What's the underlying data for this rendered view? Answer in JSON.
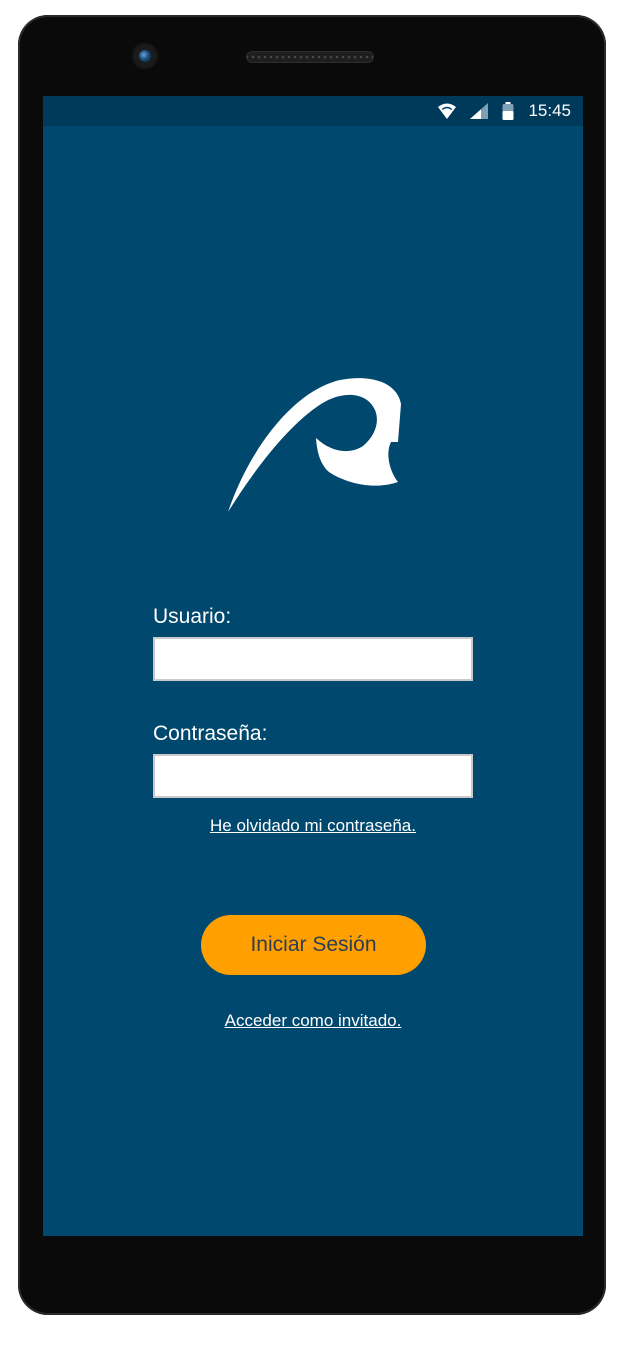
{
  "status_bar": {
    "time": "15:45",
    "icons": [
      "wifi-icon",
      "signal-icon",
      "battery-icon"
    ]
  },
  "login": {
    "username_label": "Usuario:",
    "username_value": "",
    "password_label": "Contraseña:",
    "password_value": "",
    "forgot_password_link": "He olvidado mi contraseña.",
    "login_button": "Iniciar Sesión",
    "guest_link": "Acceder como invitado."
  },
  "colors": {
    "screen_background": "#00486e",
    "status_bar_background": "#003a5a",
    "button_background": "#ffa000",
    "button_text": "#2c3e50",
    "text": "#ffffff"
  }
}
